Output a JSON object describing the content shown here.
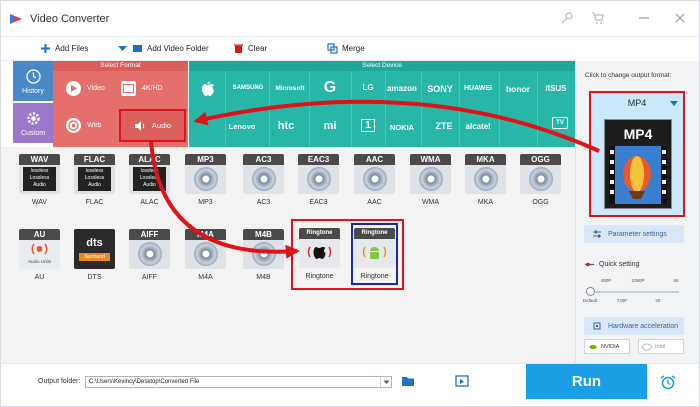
{
  "app": {
    "title": "Video Converter"
  },
  "toolbar": {
    "add_files": "Add Files",
    "add_video_folder": "Add Video Folder",
    "clear": "Clear",
    "merge": "Merge"
  },
  "sidebar": {
    "history": "History",
    "custom": "Custom"
  },
  "select_format": {
    "header": "Select Format",
    "items": [
      {
        "label": "Video",
        "icon": "play-icon"
      },
      {
        "label": "4K/HD",
        "icon": "4k-icon"
      },
      {
        "label": "Web",
        "icon": "chrome-icon"
      },
      {
        "label": "Audio",
        "icon": "speaker-icon"
      }
    ]
  },
  "select_device": {
    "header": "Select Device",
    "brands_row1": [
      "",
      "SAMSUNG",
      "Microsoft",
      "G",
      "LG",
      "amazon",
      "SONY",
      "HUAWEI",
      "honor",
      "/ISUS"
    ],
    "brands_row2": [
      "Lenovo",
      "htc",
      "mi",
      "1",
      "NOKIA",
      "ZTE",
      "alcatel",
      "TV"
    ]
  },
  "formats": [
    {
      "cap": "WAV",
      "label": "WAV",
      "style": "lossless",
      "sub": "lossless\nLossless\nAudio"
    },
    {
      "cap": "FLAC",
      "label": "FLAC",
      "style": "lossless",
      "sub": "lossless\nLossless\nAudio"
    },
    {
      "cap": "ALAC",
      "label": "ALAC",
      "style": "lossless",
      "sub": "lossless\nLossless\nAudio"
    },
    {
      "cap": "MP3",
      "label": "MP3",
      "style": "disc",
      "sub": ""
    },
    {
      "cap": "AC3",
      "label": "AC3",
      "style": "disc",
      "sub": ""
    },
    {
      "cap": "EAC3",
      "label": "EAC3",
      "style": "disc",
      "sub": ""
    },
    {
      "cap": "AAC",
      "label": "AAC",
      "style": "disc",
      "sub": ""
    },
    {
      "cap": "WMA",
      "label": "WMA",
      "style": "disc",
      "sub": ""
    },
    {
      "cap": "MKA",
      "label": "MKA",
      "style": "disc",
      "sub": ""
    },
    {
      "cap": "OGG",
      "label": "OGG",
      "style": "disc",
      "sub": ""
    },
    {
      "cap": "AU",
      "label": "AU",
      "style": "au",
      "sub": "Audio Units"
    },
    {
      "cap": "dts",
      "label": "DTS",
      "style": "dts",
      "sub": "Surround"
    },
    {
      "cap": "AIFF",
      "label": "AIFF",
      "style": "disc",
      "sub": ""
    },
    {
      "cap": "M4A",
      "label": "M4A",
      "style": "disc",
      "sub": ""
    },
    {
      "cap": "M4B",
      "label": "M4B",
      "style": "disc",
      "sub": ""
    },
    {
      "cap": "Ringtone",
      "label": "Ringtone",
      "style": "ring-apple",
      "sub": ""
    },
    {
      "cap": "Ringtone",
      "label": "Ringtone",
      "style": "ring-android",
      "sub": ""
    }
  ],
  "output": {
    "label": "Output folder:",
    "path": "C:\\Users\\Kevincy\\Desktop\\Converted File"
  },
  "run": {
    "label": "Run"
  },
  "right_panel": {
    "hint": "Click to change output format:",
    "current_format": "MP4",
    "art_label": "MP4",
    "parameter_settings": "Parameter settings",
    "quick_setting": "Quick setting",
    "ticks_top": [
      "480P",
      "1080P",
      "4K"
    ],
    "ticks_bottom": [
      "Default",
      "720P",
      "2K"
    ],
    "hardware_acceleration": "Hardware acceleration",
    "nvidia": "NVIDIA",
    "intel": "Intel"
  },
  "colors": {
    "format_red": "#e56f6a",
    "device_teal": "#28b7a7",
    "run_blue": "#1a9ee6",
    "highlight_red": "#e0121a",
    "select_blue": "#1c28a8"
  }
}
